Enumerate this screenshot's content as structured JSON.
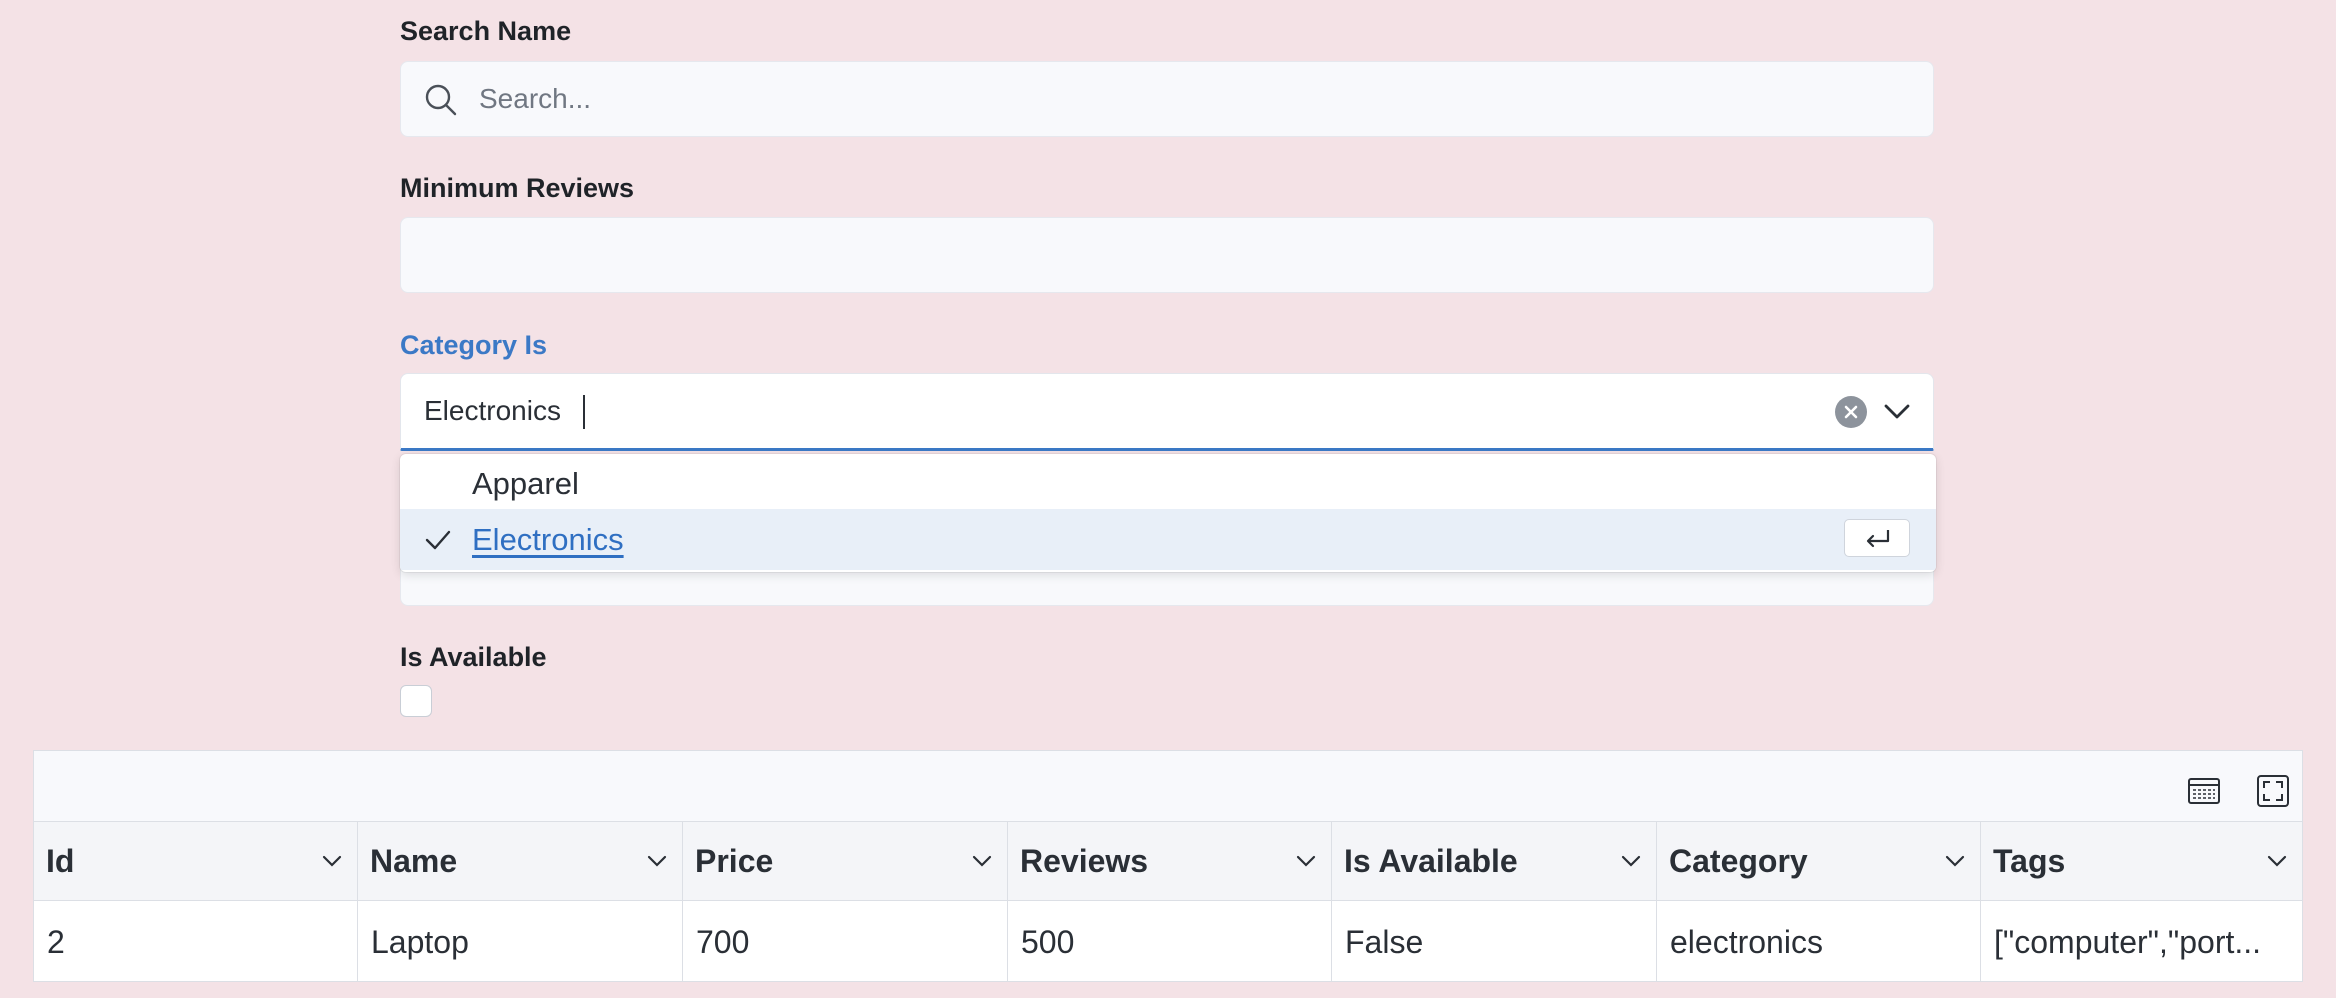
{
  "form": {
    "search": {
      "label": "Search Name",
      "placeholder": "Search...",
      "value": ""
    },
    "min_reviews": {
      "label": "Minimum Reviews",
      "value": ""
    },
    "category": {
      "label": "Category Is",
      "value": "Electronics",
      "options": [
        {
          "label": "Apparel",
          "selected": false
        },
        {
          "label": "Electronics",
          "selected": true
        }
      ]
    },
    "is_available": {
      "label": "Is Available",
      "checked": false
    }
  },
  "table": {
    "columns": [
      "Id",
      "Name",
      "Price",
      "Reviews",
      "Is Available",
      "Category",
      "Tags"
    ],
    "rows": [
      [
        "2",
        "Laptop",
        "700",
        "500",
        "False",
        "electronics",
        "[\"computer\",\"port..."
      ]
    ]
  },
  "colors": {
    "background": "#f4e2e6",
    "accent": "#3b79c6",
    "selected_option_bg": "#e8eff8"
  },
  "icons": {
    "search": "search-icon",
    "clear": "clear-icon",
    "chevron": "chevron-down-icon",
    "check": "check-icon",
    "enter": "enter-key-icon",
    "table_view": "table-view-icon",
    "fullscreen": "fullscreen-icon"
  }
}
